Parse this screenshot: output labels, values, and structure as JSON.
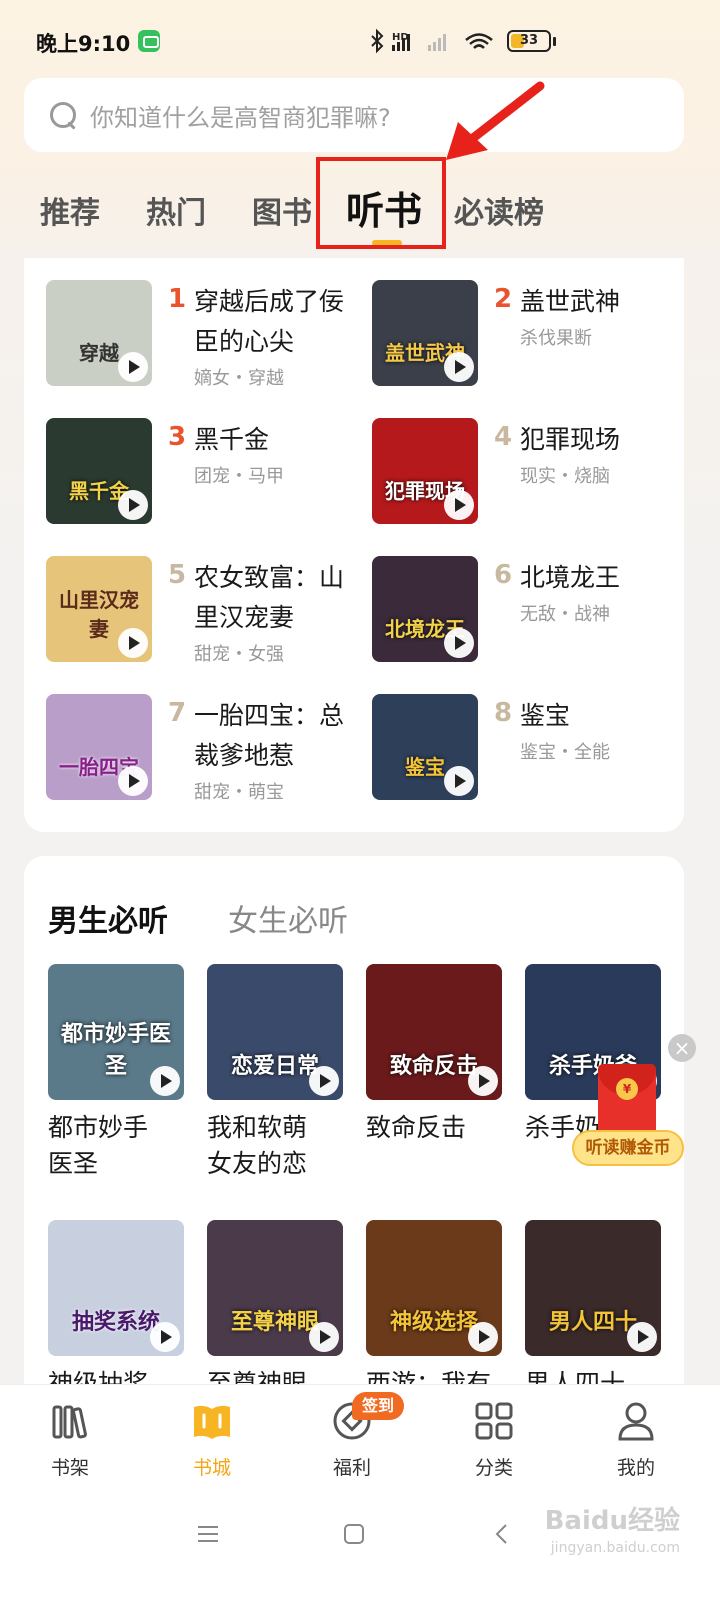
{
  "status_bar": {
    "time": "晚上9:10",
    "battery": "33",
    "battery_level_percent": 33,
    "icons": [
      "bluetooth-icon",
      "signal-hd-icon",
      "signal-icon",
      "wifi-icon"
    ]
  },
  "search": {
    "placeholder": "你知道什么是高智商犯罪嘛?"
  },
  "tabs": [
    {
      "label": "推荐"
    },
    {
      "label": "热门"
    },
    {
      "label": "图书"
    },
    {
      "label": "听书"
    },
    {
      "label": "必读榜"
    }
  ],
  "ranking": [
    {
      "rank": "1",
      "title": "穿越后成了佞臣的心尖",
      "tags": "嫡女・穿越",
      "cover_text": "穿越",
      "color": "#c9cfc4"
    },
    {
      "rank": "2",
      "title": "盖世武神",
      "tags": "杀伐果断",
      "cover_text": "盖世武神",
      "color": "#3a3f4a"
    },
    {
      "rank": "3",
      "title": "黑千金",
      "tags": "团宠・马甲",
      "cover_text": "黑千金",
      "color": "#2b3a30"
    },
    {
      "rank": "4",
      "title": "犯罪现场",
      "tags": "现实・烧脑",
      "cover_text": "犯罪现场",
      "color": "#b5191c"
    },
    {
      "rank": "5",
      "title": "农女致富：山里汉宠妻",
      "tags": "甜宠・女强",
      "cover_text": "山里汉宠妻",
      "color": "#e6c47a"
    },
    {
      "rank": "6",
      "title": "北境龙王",
      "tags": "无敌・战神",
      "cover_text": "北境龙王",
      "color": "#3a2a3a"
    },
    {
      "rank": "7",
      "title": "一胎四宝：总裁爹地惹",
      "tags": "甜宠・萌宝",
      "cover_text": "一胎四宝",
      "color": "#b89ec8"
    },
    {
      "rank": "8",
      "title": "鉴宝",
      "tags": "鉴宝・全能",
      "cover_text": "鉴宝",
      "color": "#2e3f5a"
    }
  ],
  "must_listen": {
    "tab_active": "男生必听",
    "tab_inactive": "女生必听",
    "items": [
      {
        "title": "都市妙手医圣",
        "cover_text": "都市妙手医圣",
        "color": "#5a7a8a"
      },
      {
        "title": "我和软萌女友的恋",
        "cover_text": "恋爱日常",
        "color": "#3a4a6a"
      },
      {
        "title": "致命反击",
        "cover_text": "致命反击",
        "color": "#6a1a1a"
      },
      {
        "title": "杀手奶爸",
        "cover_text": "杀手奶爸",
        "color": "#2a3a5a"
      },
      {
        "title": "神级抽奖",
        "cover_text": "抽奖系统",
        "color": "#c8d0e0"
      },
      {
        "title": "至尊神眼",
        "cover_text": "至尊神眼",
        "color": "#4a3a4a"
      },
      {
        "title": "西游：我有",
        "cover_text": "神级选择",
        "color": "#6a3a1a"
      },
      {
        "title": "男人四十",
        "cover_text": "男人四十",
        "color": "#3a2a2a"
      }
    ],
    "visible_titles": [
      "都市妙手\n医圣",
      "我和软萌\n女友的恋",
      "致命反击",
      "杀手奶",
      "神级抽奖",
      "至尊神眼",
      "西游：我有",
      "男人四十"
    ]
  },
  "floating": {
    "label": "听读赚金币",
    "close": "×"
  },
  "bottom_nav": [
    {
      "label": "书架",
      "icon": "bookshelf-icon"
    },
    {
      "label": "书城",
      "icon": "book-city-icon"
    },
    {
      "label": "福利",
      "icon": "welfare-icon"
    },
    {
      "label": "分类",
      "icon": "category-icon"
    },
    {
      "label": "我的",
      "icon": "profile-icon"
    }
  ],
  "badge": "签到",
  "watermark": "Baidu经验",
  "watermark_sub": "jingyan.baidu.com",
  "colors": {
    "accent": "#f3a716",
    "rank_top": "#e9542f",
    "rank_other": "#c9b8a0",
    "highlight": "#e7221b"
  }
}
